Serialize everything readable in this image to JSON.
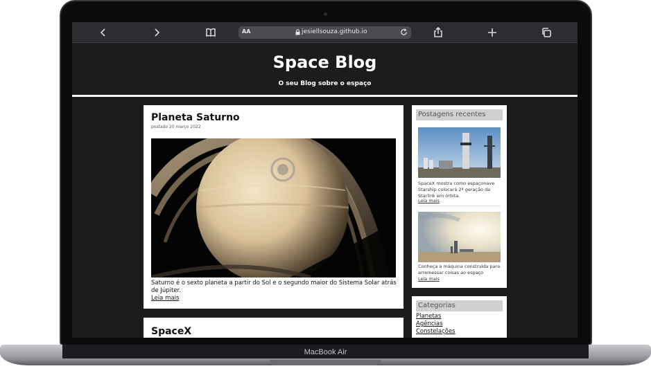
{
  "device": {
    "label": "MacBook Air"
  },
  "browser": {
    "text_size_label": "AA",
    "url": "jesiellsouza.github.io"
  },
  "site": {
    "title": "Space Blog",
    "subtitle": "O seu Blog sobre o espaço"
  },
  "posts": [
    {
      "title": "Planeta Saturno",
      "date": "postado 20 março 2022",
      "excerpt": "Saturno é o sexto planeta a partir do Sol e o segundo maior do Sistema Solar atrás de Júpiter.",
      "read_more": "Leia mais"
    },
    {
      "title": "SpaceX"
    }
  ],
  "sidebar": {
    "recent": {
      "heading": "Postagens recentes",
      "items": [
        {
          "text": "SpaceX mostra como espaçonave Starship colocará 2ª geração da Starlink em órbita.",
          "read_more": "Leia mais"
        },
        {
          "text": "Conheça a máquina construída para arremessar coisas ao espaço",
          "read_more": "Leia mais"
        }
      ]
    },
    "categories": {
      "heading": "Categorias",
      "items": [
        "Planetas",
        "Agências",
        "Constelações"
      ]
    }
  },
  "colors": {
    "page_bg": "#1d1c1c",
    "card_bg": "#ffffff",
    "sidebar_heading_bg": "#d0d0d0"
  }
}
